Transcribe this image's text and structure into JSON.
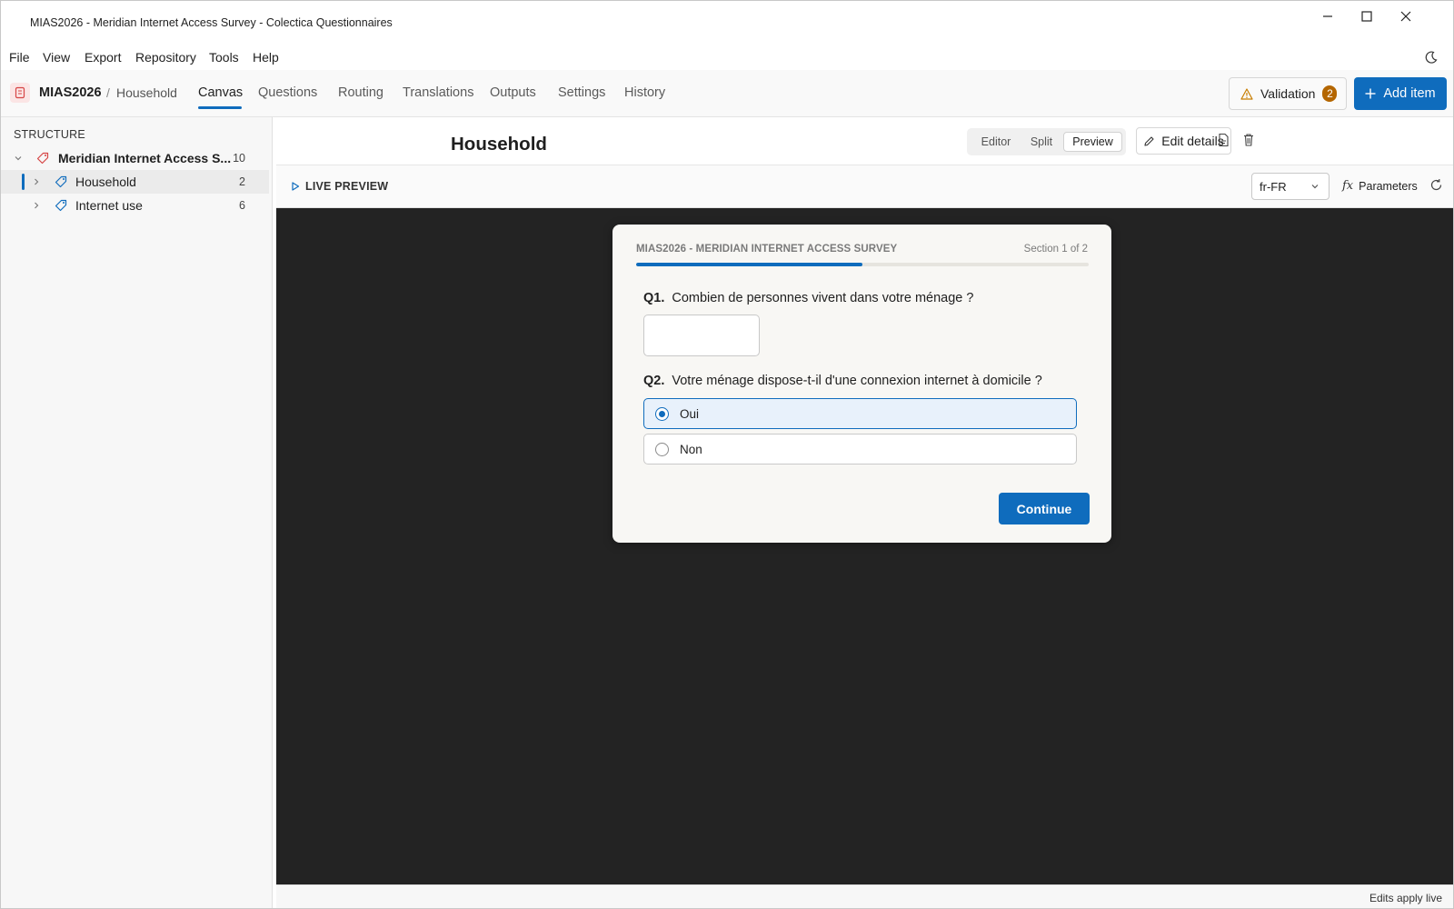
{
  "window": {
    "title": "MIAS2026 - Meridian Internet Access Survey - Colectica Questionnaires"
  },
  "menu": [
    "File",
    "View",
    "Export",
    "Repository",
    "Tools",
    "Help"
  ],
  "header": {
    "crumb_root": "MIAS2026",
    "crumb_sep": "/",
    "crumb_leaf": "Household",
    "tabs": [
      "Canvas",
      "Questions",
      "Routing",
      "Translations",
      "Outputs",
      "Settings",
      "History"
    ],
    "active_tab": "Canvas",
    "validation_label": "Validation",
    "validation_count": "2",
    "add_label": "Add item"
  },
  "sidebar": {
    "heading": "STRUCTURE",
    "root": {
      "label": "Meridian Internet Access S...",
      "count": "10"
    },
    "items": [
      {
        "label": "Household",
        "count": "2",
        "selected": true
      },
      {
        "label": "Internet use",
        "count": "6",
        "selected": false
      }
    ]
  },
  "main": {
    "title": "Household",
    "view_modes": [
      "Editor",
      "Split",
      "Preview"
    ],
    "active_mode": "Preview",
    "edit_label": "Edit details",
    "preview_label": "LIVE PREVIEW",
    "language": "fr-FR",
    "params_label": "Parameters",
    "status": "Edits apply live"
  },
  "survey": {
    "subtitle": "MIAS2026 - MERIDIAN INTERNET ACCESS SURVEY",
    "section": "Section 1 of 2",
    "progress": 0.5,
    "q1": {
      "num": "Q1.",
      "text": "Combien de personnes vivent dans votre ménage ?",
      "value": ""
    },
    "q2": {
      "num": "Q2.",
      "text": "Votre ménage dispose-t-il d'une connexion internet à domicile ?"
    },
    "options": [
      {
        "label": "Oui",
        "selected": true
      },
      {
        "label": "Non",
        "selected": false
      }
    ],
    "continue_label": "Continue"
  },
  "colors": {
    "accent": "#0f6cbd",
    "stage": "#232323",
    "warning": "#b46600"
  }
}
